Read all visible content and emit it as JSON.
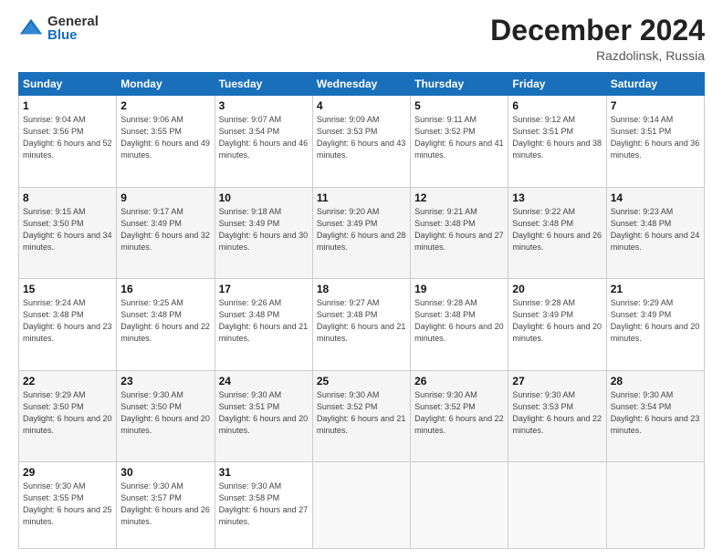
{
  "logo": {
    "general": "General",
    "blue": "Blue"
  },
  "title": "December 2024",
  "location": "Razdolinsk, Russia",
  "weekdays": [
    "Sunday",
    "Monday",
    "Tuesday",
    "Wednesday",
    "Thursday",
    "Friday",
    "Saturday"
  ],
  "weeks": [
    [
      {
        "day": "1",
        "sunrise": "9:04 AM",
        "sunset": "3:56 PM",
        "daylight": "6 hours and 52 minutes."
      },
      {
        "day": "2",
        "sunrise": "9:06 AM",
        "sunset": "3:55 PM",
        "daylight": "6 hours and 49 minutes."
      },
      {
        "day": "3",
        "sunrise": "9:07 AM",
        "sunset": "3:54 PM",
        "daylight": "6 hours and 46 minutes."
      },
      {
        "day": "4",
        "sunrise": "9:09 AM",
        "sunset": "3:53 PM",
        "daylight": "6 hours and 43 minutes."
      },
      {
        "day": "5",
        "sunrise": "9:11 AM",
        "sunset": "3:52 PM",
        "daylight": "6 hours and 41 minutes."
      },
      {
        "day": "6",
        "sunrise": "9:12 AM",
        "sunset": "3:51 PM",
        "daylight": "6 hours and 38 minutes."
      },
      {
        "day": "7",
        "sunrise": "9:14 AM",
        "sunset": "3:51 PM",
        "daylight": "6 hours and 36 minutes."
      }
    ],
    [
      {
        "day": "8",
        "sunrise": "9:15 AM",
        "sunset": "3:50 PM",
        "daylight": "6 hours and 34 minutes."
      },
      {
        "day": "9",
        "sunrise": "9:17 AM",
        "sunset": "3:49 PM",
        "daylight": "6 hours and 32 minutes."
      },
      {
        "day": "10",
        "sunrise": "9:18 AM",
        "sunset": "3:49 PM",
        "daylight": "6 hours and 30 minutes."
      },
      {
        "day": "11",
        "sunrise": "9:20 AM",
        "sunset": "3:49 PM",
        "daylight": "6 hours and 28 minutes."
      },
      {
        "day": "12",
        "sunrise": "9:21 AM",
        "sunset": "3:48 PM",
        "daylight": "6 hours and 27 minutes."
      },
      {
        "day": "13",
        "sunrise": "9:22 AM",
        "sunset": "3:48 PM",
        "daylight": "6 hours and 26 minutes."
      },
      {
        "day": "14",
        "sunrise": "9:23 AM",
        "sunset": "3:48 PM",
        "daylight": "6 hours and 24 minutes."
      }
    ],
    [
      {
        "day": "15",
        "sunrise": "9:24 AM",
        "sunset": "3:48 PM",
        "daylight": "6 hours and 23 minutes."
      },
      {
        "day": "16",
        "sunrise": "9:25 AM",
        "sunset": "3:48 PM",
        "daylight": "6 hours and 22 minutes."
      },
      {
        "day": "17",
        "sunrise": "9:26 AM",
        "sunset": "3:48 PM",
        "daylight": "6 hours and 21 minutes."
      },
      {
        "day": "18",
        "sunrise": "9:27 AM",
        "sunset": "3:48 PM",
        "daylight": "6 hours and 21 minutes."
      },
      {
        "day": "19",
        "sunrise": "9:28 AM",
        "sunset": "3:48 PM",
        "daylight": "6 hours and 20 minutes."
      },
      {
        "day": "20",
        "sunrise": "9:28 AM",
        "sunset": "3:49 PM",
        "daylight": "6 hours and 20 minutes."
      },
      {
        "day": "21",
        "sunrise": "9:29 AM",
        "sunset": "3:49 PM",
        "daylight": "6 hours and 20 minutes."
      }
    ],
    [
      {
        "day": "22",
        "sunrise": "9:29 AM",
        "sunset": "3:50 PM",
        "daylight": "6 hours and 20 minutes."
      },
      {
        "day": "23",
        "sunrise": "9:30 AM",
        "sunset": "3:50 PM",
        "daylight": "6 hours and 20 minutes."
      },
      {
        "day": "24",
        "sunrise": "9:30 AM",
        "sunset": "3:51 PM",
        "daylight": "6 hours and 20 minutes."
      },
      {
        "day": "25",
        "sunrise": "9:30 AM",
        "sunset": "3:52 PM",
        "daylight": "6 hours and 21 minutes."
      },
      {
        "day": "26",
        "sunrise": "9:30 AM",
        "sunset": "3:52 PM",
        "daylight": "6 hours and 22 minutes."
      },
      {
        "day": "27",
        "sunrise": "9:30 AM",
        "sunset": "3:53 PM",
        "daylight": "6 hours and 22 minutes."
      },
      {
        "day": "28",
        "sunrise": "9:30 AM",
        "sunset": "3:54 PM",
        "daylight": "6 hours and 23 minutes."
      }
    ],
    [
      {
        "day": "29",
        "sunrise": "9:30 AM",
        "sunset": "3:55 PM",
        "daylight": "6 hours and 25 minutes."
      },
      {
        "day": "30",
        "sunrise": "9:30 AM",
        "sunset": "3:57 PM",
        "daylight": "6 hours and 26 minutes."
      },
      {
        "day": "31",
        "sunrise": "9:30 AM",
        "sunset": "3:58 PM",
        "daylight": "6 hours and 27 minutes."
      },
      null,
      null,
      null,
      null
    ]
  ]
}
